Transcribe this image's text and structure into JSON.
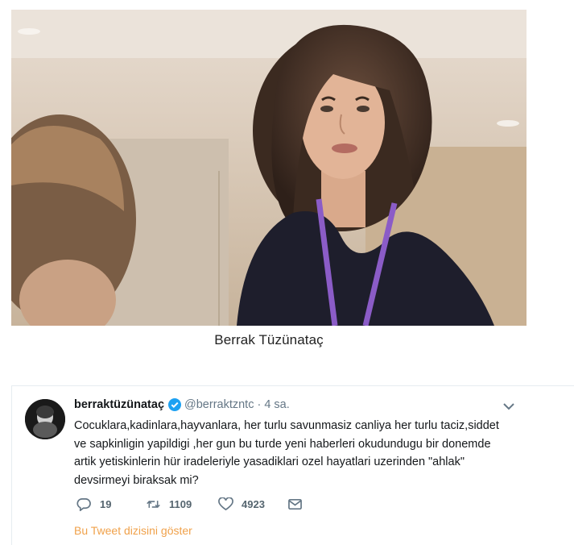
{
  "caption": "Berrak Tüzünataç",
  "tweet": {
    "display_name": "berraktüzünataç",
    "handle": "@berraktzntc",
    "separator": "·",
    "time": "4 sa.",
    "text_lines": [
      "Cocuklara,kadinlara,hayvanlara, her turlu savunmasiz canliya her turlu taciz,siddet",
      "ve sapkinligin yapildigi ,her gun bu turde yeni haberleri okudundugu bir donemde",
      "artik yetiskinlerin hür iradeleriyle yasadiklari ozel hayatlari uzerinden \"ahlak\"",
      "devsirmeyi biraksak mi?"
    ],
    "reply_count": "19",
    "retweet_count": "1109",
    "like_count": "4923",
    "show_thread": "Bu Tweet dizisini göster"
  },
  "icons": {
    "verified": "verified-badge-icon",
    "menu": "chevron-down-icon",
    "reply": "reply-icon",
    "retweet": "retweet-icon",
    "like": "heart-icon",
    "dm": "envelope-icon"
  },
  "colors": {
    "verified": "#1da1f2",
    "link": "#f0a14a",
    "meta": "#657786",
    "lanyard": "#8b5cc7"
  }
}
